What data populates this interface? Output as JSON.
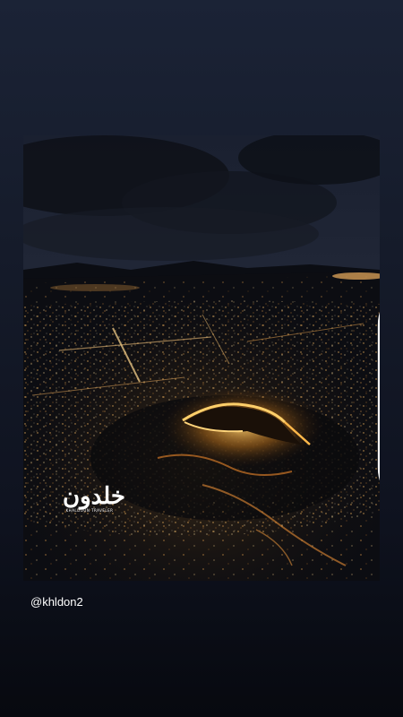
{
  "story": {
    "username": "@khldon2",
    "watermark": {
      "logo_text": "خلدون",
      "subtitle": "KHALDOUN TRAVELER"
    },
    "icons": {
      "multi_post": "multiple-images-icon"
    },
    "image_description_colors": {
      "sky": "#1b2030",
      "city_lights": "#f5a742",
      "ground": "#0a0c12"
    }
  }
}
